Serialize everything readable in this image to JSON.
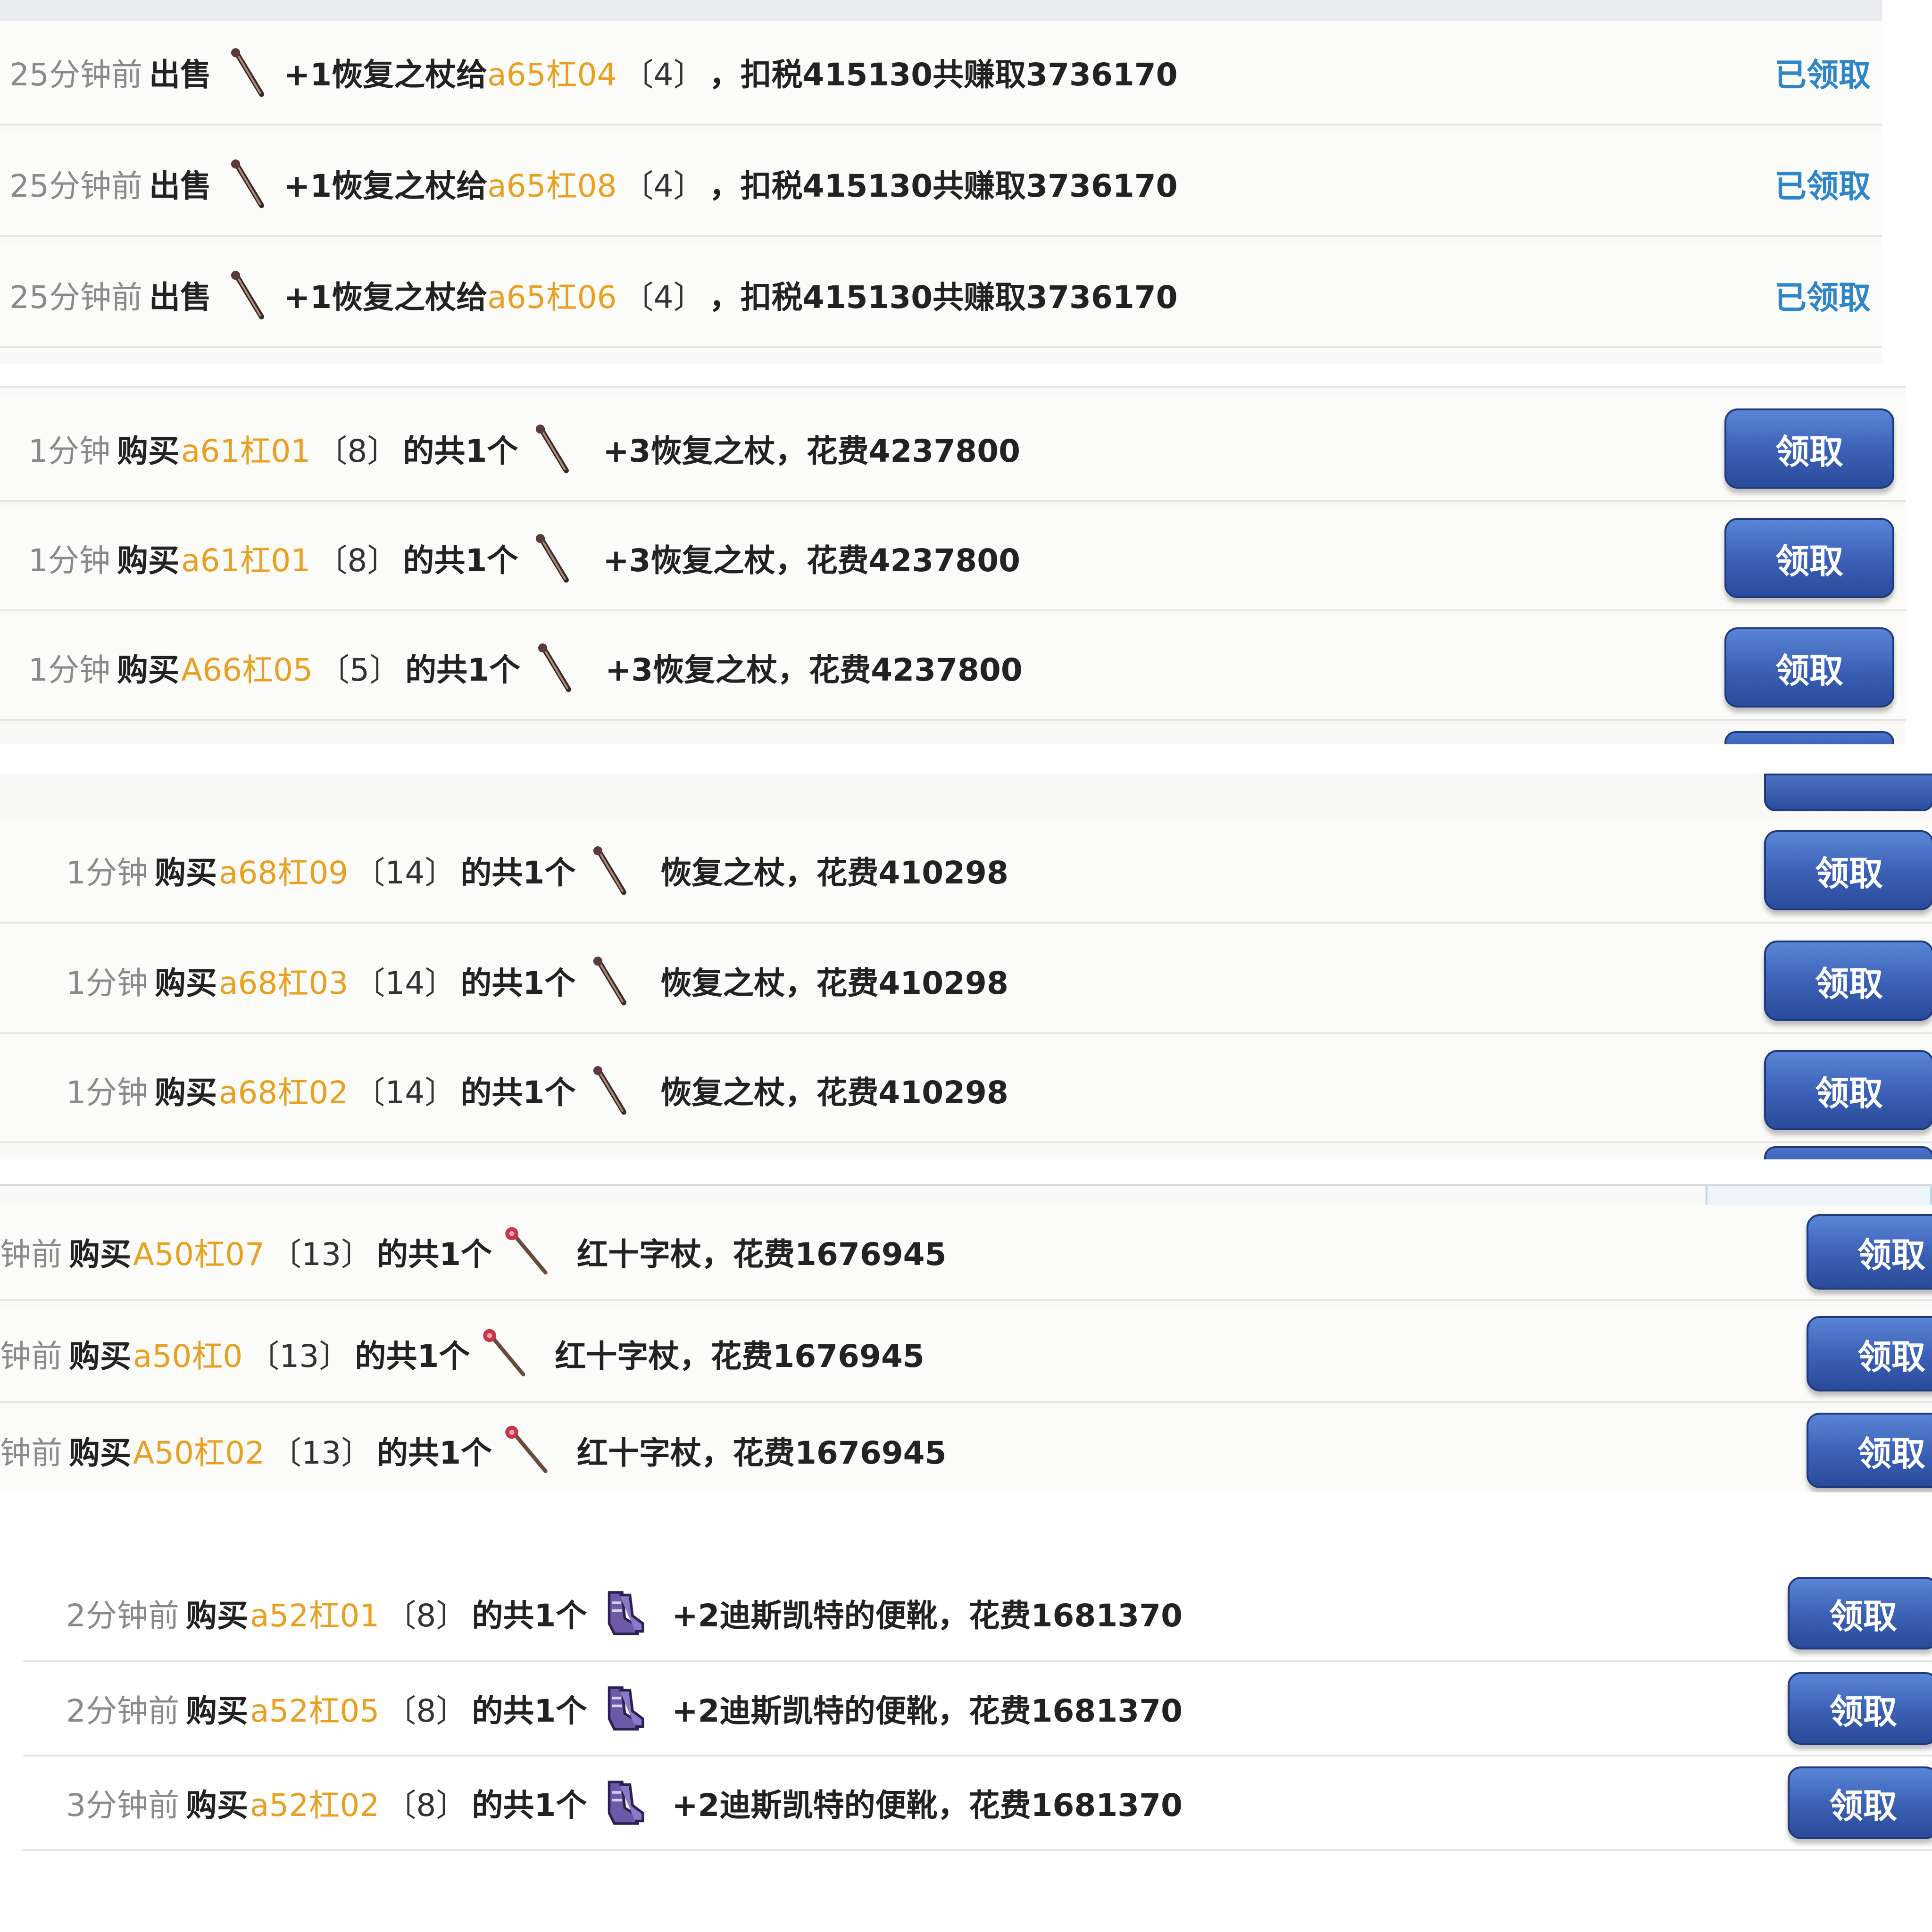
{
  "sections": [
    {
      "rows": [
        {
          "time": "25分钟前",
          "action": "出售",
          "detail_pre": "+1恢复之杖给",
          "player": "a65杠04",
          "count": "〔4〕",
          "detail": "，扣税415130共赚取3736170",
          "status": "已领取",
          "icon": "staff-icon"
        },
        {
          "time": "25分钟前",
          "action": "出售",
          "detail_pre": "+1恢复之杖给",
          "player": "a65杠08",
          "count": "〔4〕",
          "detail": "，扣税415130共赚取3736170",
          "status": "已领取",
          "icon": "staff-icon"
        },
        {
          "time": "25分钟前",
          "action": "出售",
          "detail_pre": "+1恢复之杖给",
          "player": "a65杠06",
          "count": "〔4〕",
          "detail": "，扣税415130共赚取3736170",
          "status": "已领取",
          "icon": "staff-icon"
        }
      ]
    },
    {
      "rows": [
        {
          "time": "1分钟",
          "action": "购买",
          "player": "a61杠01",
          "count": "〔8〕",
          "mid": "的共1个",
          "item": "+3恢复之杖，花费4237800",
          "button": "领取",
          "icon": "staff-icon"
        },
        {
          "time": "1分钟",
          "action": "购买",
          "player": "a61杠01",
          "count": "〔8〕",
          "mid": "的共1个",
          "item": "+3恢复之杖，花费4237800",
          "button": "领取",
          "icon": "staff-icon"
        },
        {
          "time": "1分钟",
          "action": "购买",
          "player": "A66杠05",
          "count": "〔5〕",
          "mid": "的共1个",
          "item": "+3恢复之杖，花费4237800",
          "button": "领取",
          "icon": "staff-icon"
        }
      ]
    },
    {
      "rows": [
        {
          "time": "1分钟",
          "action": "购买",
          "player": "a68杠09",
          "count": "〔14〕",
          "mid": "的共1个",
          "item": "恢复之杖，花费410298",
          "button": "领取",
          "icon": "staff-icon"
        },
        {
          "time": "1分钟",
          "action": "购买",
          "player": "a68杠03",
          "count": "〔14〕",
          "mid": "的共1个",
          "item": "恢复之杖，花费410298",
          "button": "领取",
          "icon": "staff-icon"
        },
        {
          "time": "1分钟",
          "action": "购买",
          "player": "a68杠02",
          "count": "〔14〕",
          "mid": "的共1个",
          "item": "恢复之杖，花费410298",
          "button": "领取",
          "icon": "staff-icon"
        }
      ]
    },
    {
      "rows": [
        {
          "time": "钟前",
          "action": "购买",
          "player": "A50杠07",
          "count": "〔13〕",
          "mid": "的共1个",
          "item": "红十字杖，花费1676945",
          "button": "领取",
          "icon": "red-cross-staff-icon"
        },
        {
          "time": "钟前",
          "action": "购买",
          "player": "a50杠0",
          "count": "〔13〕",
          "mid": "的共1个",
          "item": "红十字杖，花费1676945",
          "button": "领取",
          "icon": "red-cross-staff-icon"
        },
        {
          "time": "钟前",
          "action": "购买",
          "player": "A50杠02",
          "count": "〔13〕",
          "mid": "的共1个",
          "item": "红十字杖，花费1676945",
          "button": "领取",
          "icon": "red-cross-staff-icon"
        }
      ]
    },
    {
      "rows": [
        {
          "time": "2分钟前",
          "action": "购买",
          "player": "a52杠01",
          "count": "〔8〕",
          "mid": "的共1个",
          "item": "+2迪斯凯特的便靴，花费1681370",
          "button": "领取",
          "icon": "boots-icon"
        },
        {
          "time": "2分钟前",
          "action": "购买",
          "player": "a52杠05",
          "count": "〔8〕",
          "mid": "的共1个",
          "item": "+2迪斯凯特的便靴，花费1681370",
          "button": "领取",
          "icon": "boots-icon"
        },
        {
          "time": "3分钟前",
          "action": "购买",
          "player": "a52杠02",
          "count": "〔8〕",
          "mid": "的共1个",
          "item": "+2迪斯凯特的便靴，花费1681370",
          "button": "领取",
          "icon": "boots-icon"
        }
      ]
    }
  ],
  "colors": {
    "player": "#e9a020",
    "claimed": "#2e86c8",
    "button": "#3a5fb4"
  }
}
